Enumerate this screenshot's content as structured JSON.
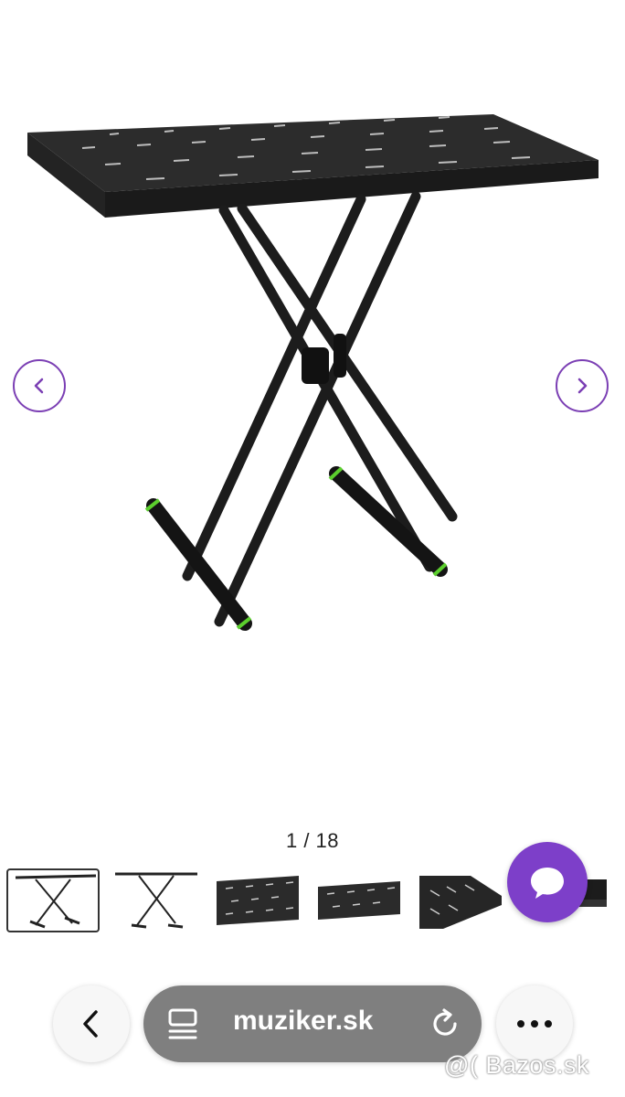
{
  "gallery": {
    "counter": "1 / 18",
    "prev_icon": "chevron-left-icon",
    "next_icon": "chevron-right-icon",
    "accent_color": "#7b3fb4",
    "thumbnails": 6
  },
  "chat": {
    "icon": "chat-bubble-icon",
    "color": "#7d3fc9"
  },
  "browser": {
    "back_icon": "chevron-left-icon",
    "reader_icon": "reader-mode-icon",
    "url": "muziker.sk",
    "reload_icon": "reload-icon",
    "more_icon": "more-dots-icon"
  },
  "watermark": "@( Bazos.sk"
}
